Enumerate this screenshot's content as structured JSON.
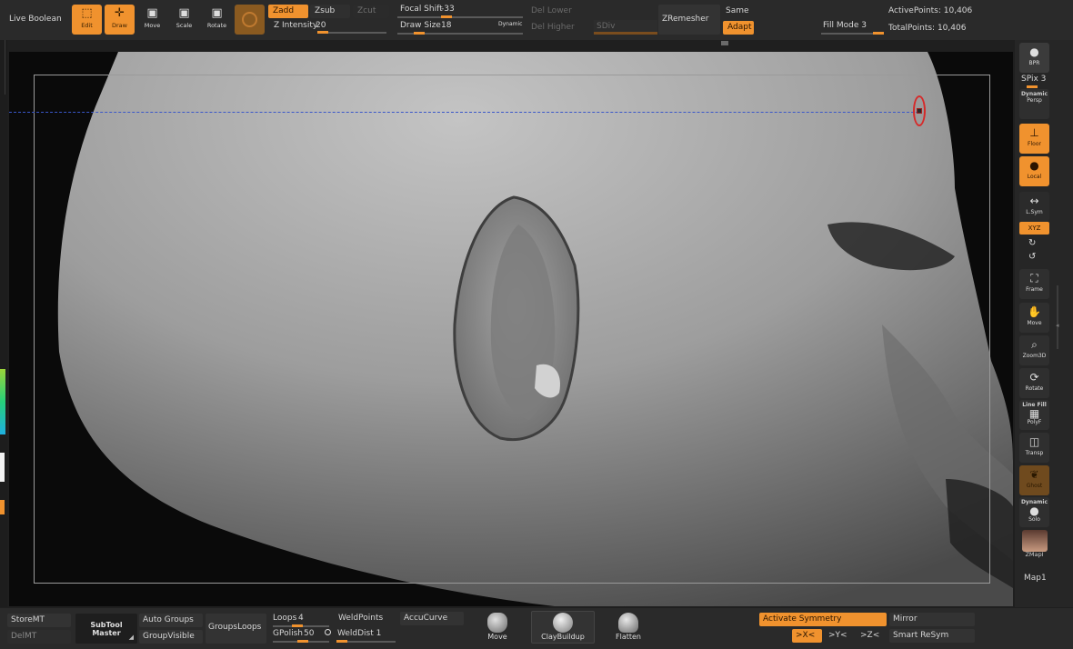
{
  "topbar": {
    "live_boolean": "Live Boolean",
    "edit": "Edit",
    "draw": "Draw",
    "move": "Move",
    "scale": "Scale",
    "rotate": "Rotate",
    "zadd": "Zadd",
    "zsub": "Zsub",
    "zcut": "Zcut",
    "z_intensity_label": "Z Intensity",
    "z_intensity_value": "20",
    "focal_shift_label": "Focal Shift",
    "focal_shift_value": "-33",
    "draw_size_label": "Draw Size",
    "draw_size_value": "18",
    "dynamic": "Dynamic",
    "del_lower": "Del Lower",
    "del_higher": "Del Higher",
    "sdiv": "SDiv",
    "zremesher": "ZRemesher",
    "same": "Same",
    "adapt": "Adapt",
    "fill_mode": "Fill Mode 3",
    "active_points": "ActivePoints: 10,406",
    "total_points": "TotalPoints: 10,406"
  },
  "rightshelf": {
    "bpr": "BPR",
    "spix": "SPix 3",
    "dynamic": "Dynamic",
    "persp": "Persp",
    "floor": "Floor",
    "local": "Local",
    "lsym": "L.Sym",
    "xyz": "XYZ",
    "frame": "Frame",
    "move": "Move",
    "zoom3d": "Zoom3D",
    "rotate": "Rotate",
    "line_fill": "Line Fill",
    "polyf": "PolyF",
    "transp": "Transp",
    "ghost": "Ghost",
    "dynamic_solo": "Dynamic",
    "solo": "Solo",
    "zmapi": "ZMapI",
    "map1": "Map1"
  },
  "bottombar": {
    "storemt": "StoreMT",
    "delmt": "DelMT",
    "subtool_master": "SubTool Master",
    "auto_groups": "Auto Groups",
    "group_visible": "GroupVisible",
    "groups_loops": "GroupsLoops",
    "loops_label": "Loops",
    "loops_value": "4",
    "gpolish_label": "GPolish",
    "gpolish_value": "50",
    "weld_points": "WeldPoints",
    "weld_dist": "WeldDist 1",
    "accucurve": "AccuCurve",
    "brush_move": "Move",
    "brush_claybuildup": "ClayBuildup",
    "brush_flatten": "Flatten",
    "activate_symmetry": "Activate Symmetry",
    "mirror": "Mirror",
    "axis_x": ">X<",
    "axis_y": ">Y<",
    "axis_z": ">Z<",
    "smart_resym": "Smart ReSym"
  },
  "colors": {
    "accent": "#f0922e",
    "panel": "#2a2a2a",
    "symmetry_line": "#3a57c9"
  }
}
